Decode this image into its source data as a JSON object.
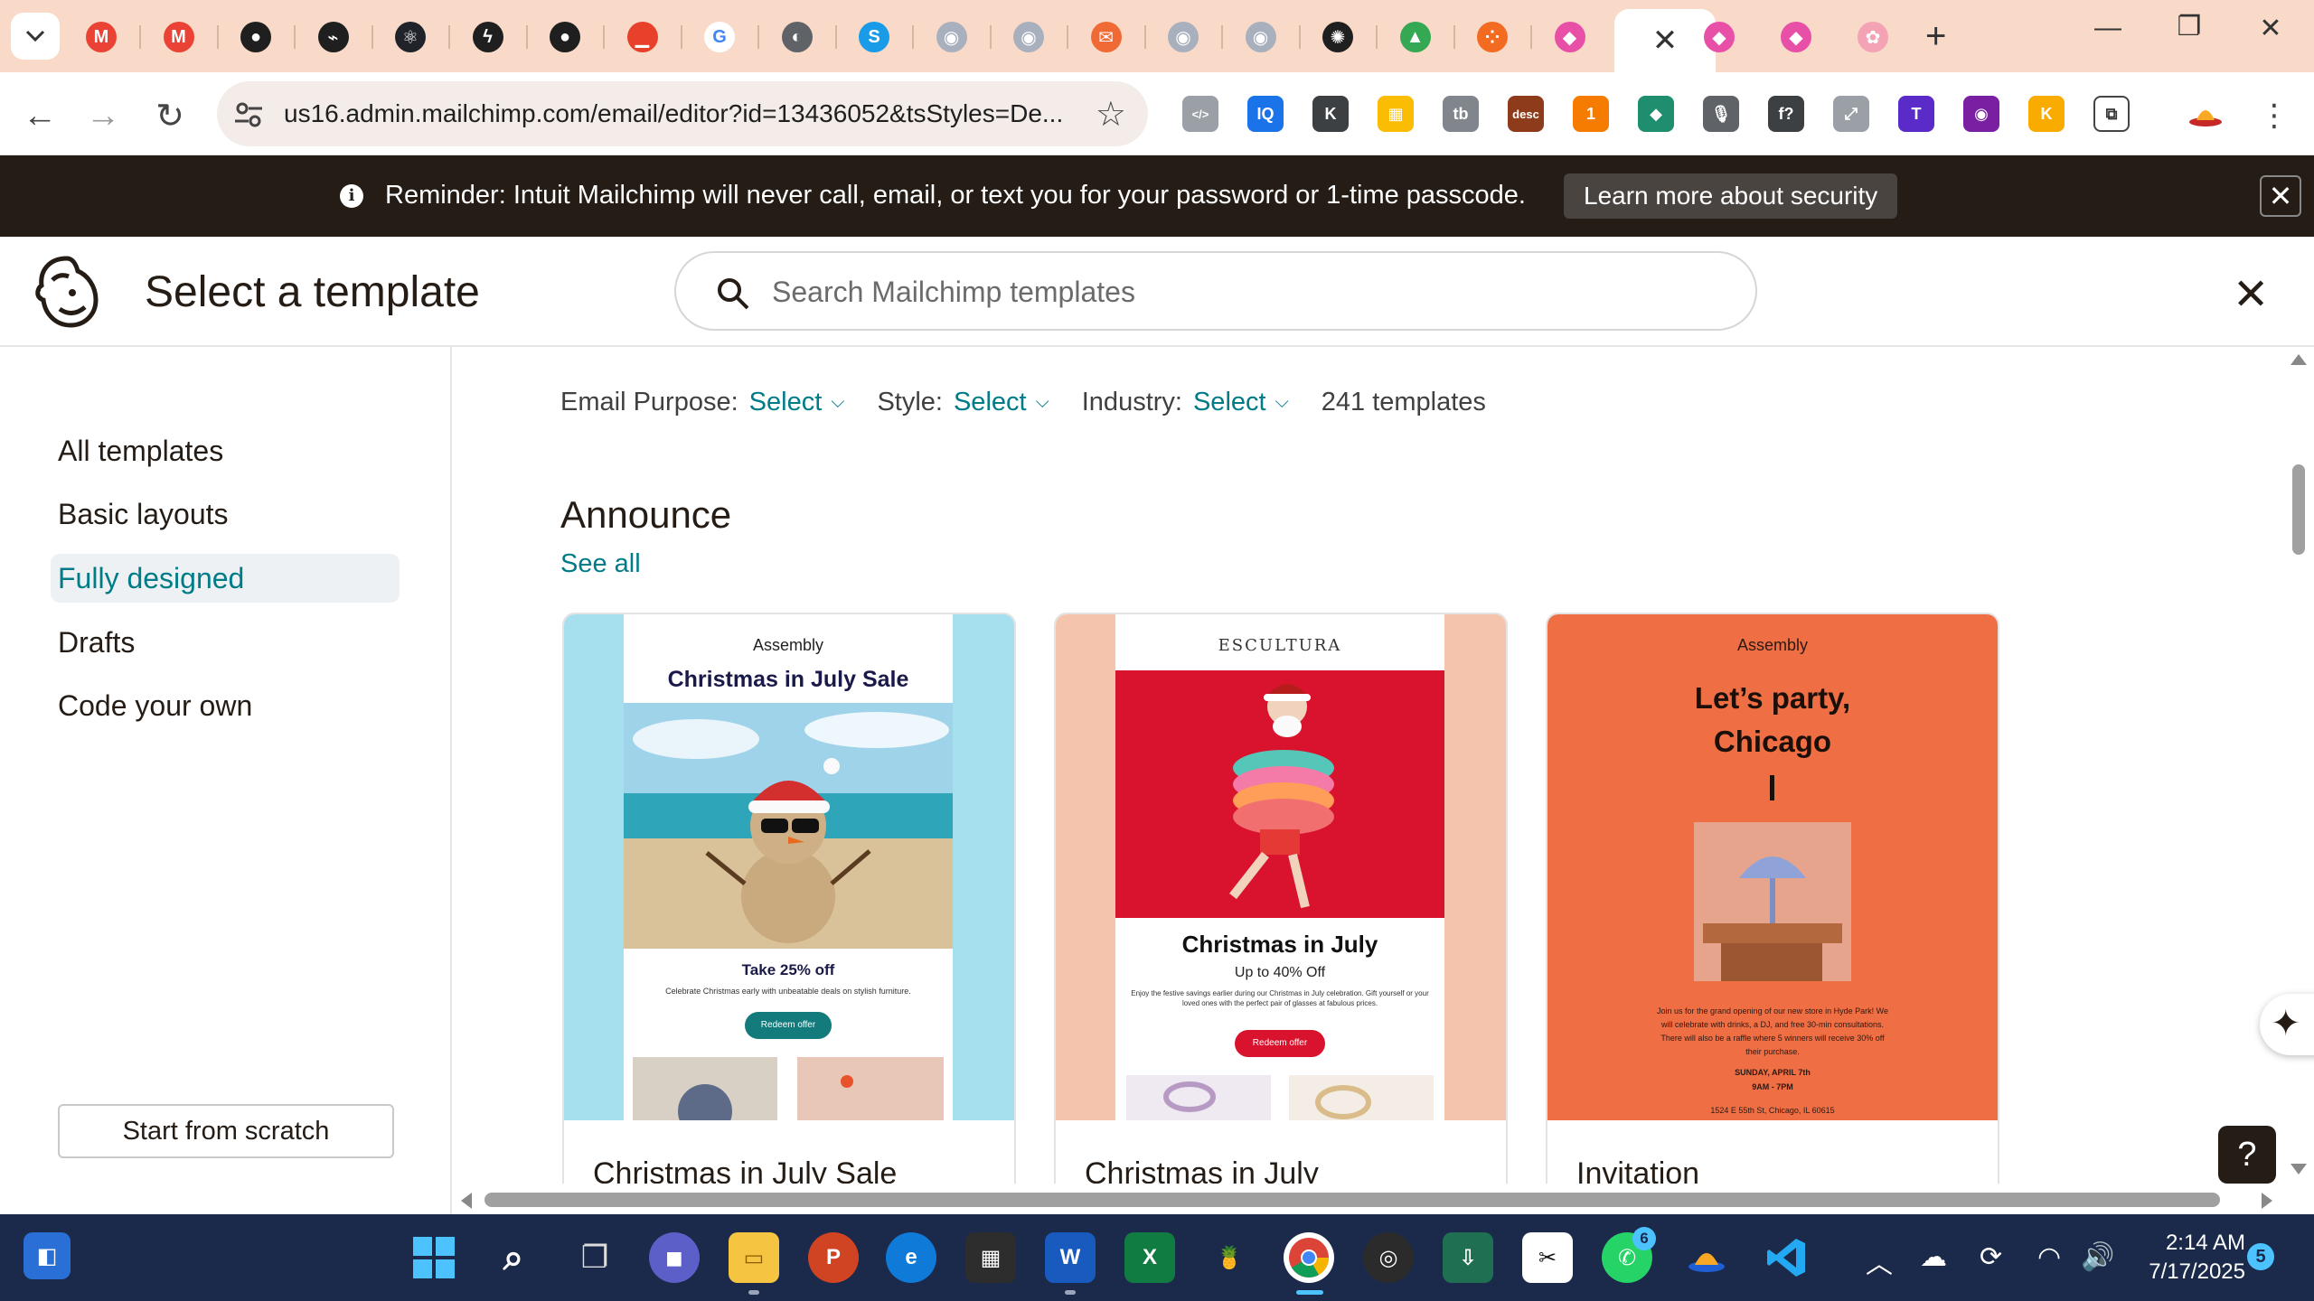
{
  "browser": {
    "url": "us16.admin.mailchimp.com/email/editor?id=13436052&tsStyles=De...",
    "tabs": [
      {
        "icon": "gmail-icon",
        "color": "#ea4335",
        "glyph": "M"
      },
      {
        "icon": "gmail-icon",
        "color": "#ea4335",
        "glyph": "M"
      },
      {
        "icon": "github-icon",
        "color": "#1f1f1f",
        "glyph": "●"
      },
      {
        "icon": "link-tool-icon",
        "color": "#1f1f1f",
        "glyph": "⌁"
      },
      {
        "icon": "react-icon",
        "color": "#20232a",
        "glyph": "⚛"
      },
      {
        "icon": "supabase-icon",
        "color": "#1f1f1f",
        "glyph": "ϟ"
      },
      {
        "icon": "github-icon",
        "color": "#1f1f1f",
        "glyph": "●"
      },
      {
        "icon": "red-square-icon",
        "color": "#e8412b",
        "glyph": "▁"
      },
      {
        "icon": "google-icon",
        "color": "#ffffff",
        "glyph": "G"
      },
      {
        "icon": "globe-icon",
        "color": "#5f6368",
        "glyph": "◐"
      },
      {
        "icon": "skype-icon",
        "color": "#1a9be8",
        "glyph": "S"
      },
      {
        "icon": "avatar-tab-icon",
        "color": "#a8b0bd",
        "glyph": "◉"
      },
      {
        "icon": "avatar-tab-icon",
        "color": "#a8b0bd",
        "glyph": "◉"
      },
      {
        "icon": "mail-icon",
        "color": "#f06a35",
        "glyph": "✉"
      },
      {
        "icon": "avatar-tab-icon",
        "color": "#a8b0bd",
        "glyph": "◉"
      },
      {
        "icon": "avatar-tab-icon",
        "color": "#a8b0bd",
        "glyph": "◉"
      },
      {
        "icon": "openai-icon",
        "color": "#1f1f1f",
        "glyph": "✺"
      },
      {
        "icon": "google-drive-icon",
        "color": "#34a853",
        "glyph": "▲"
      },
      {
        "icon": "dots-app-icon",
        "color": "#f36b21",
        "glyph": "⁘"
      },
      {
        "icon": "clickup-icon",
        "color": "#e84fa7",
        "glyph": "◆"
      }
    ],
    "tabs_right": [
      {
        "icon": "clickup-icon",
        "color": "#e84fa7",
        "glyph": "◆"
      },
      {
        "icon": "clickup-icon",
        "color": "#e84fa7",
        "glyph": "◆"
      },
      {
        "icon": "brain-icon",
        "color": "#f4a3b5",
        "glyph": "✿"
      }
    ],
    "extensions": [
      {
        "icon": "code-ext-icon",
        "color": "#9aa0a6",
        "glyph": "</>"
      },
      {
        "icon": "iq-ext-icon",
        "color": "#1a73e8",
        "glyph": "IQ"
      },
      {
        "icon": "k-ext-icon",
        "color": "#3c4043",
        "glyph": "K"
      },
      {
        "icon": "grid-ext-icon",
        "color": "#fbbc04",
        "glyph": "▦"
      },
      {
        "icon": "tb-ext-icon",
        "color": "#80868b",
        "glyph": "tb"
      },
      {
        "icon": "desc-ext-icon",
        "color": "#8d3b1b",
        "glyph": "desc"
      },
      {
        "icon": "badge-ext-icon",
        "color": "#f57c00",
        "glyph": "1"
      },
      {
        "icon": "diamond-ext-icon",
        "color": "#1e8e6e",
        "glyph": "◆"
      },
      {
        "icon": "mic-icon",
        "color": "#5f6368",
        "glyph": "🎙"
      },
      {
        "icon": "formula-ext-icon",
        "color": "#3c4043",
        "glyph": "f?"
      },
      {
        "icon": "expand-icon",
        "color": "#9aa0a6",
        "glyph": "⤢"
      },
      {
        "icon": "t-ext-icon",
        "color": "#5b2bc9",
        "glyph": "T"
      },
      {
        "icon": "eye-ext-icon",
        "color": "#7b1fa2",
        "glyph": "◉"
      },
      {
        "icon": "k-yellow-ext-icon",
        "color": "#f9ab00",
        "glyph": "K"
      },
      {
        "icon": "puzzle-icon",
        "color": "#ffffff",
        "glyph": "⧉"
      }
    ]
  },
  "banner": {
    "message": "Reminder: Intuit Mailchimp will never call, email, or text you for your password or 1-time passcode.",
    "button": "Learn more about security"
  },
  "header": {
    "title": "Select a template",
    "search_placeholder": "Search Mailchimp templates"
  },
  "sidebar": {
    "items": [
      {
        "label": "All templates",
        "active": false
      },
      {
        "label": "Basic layouts",
        "active": false
      },
      {
        "label": "Fully designed",
        "active": true
      },
      {
        "label": "Drafts",
        "active": false
      },
      {
        "label": "Code your own",
        "active": false
      }
    ],
    "scratch_button": "Start from scratch"
  },
  "filters": {
    "email_purpose_label": "Email Purpose:",
    "email_purpose_value": "Select",
    "style_label": "Style:",
    "style_value": "Select",
    "industry_label": "Industry:",
    "industry_value": "Select",
    "count": "241 templates"
  },
  "section": {
    "title": "Announce",
    "see_all": "See all"
  },
  "cards": [
    {
      "name": "Christmas in July Sale",
      "brand": "Assembly",
      "headline": "Christmas in July Sale",
      "offer": "Take 25% off",
      "body": "Celebrate Christmas early with unbeatable deals on stylish furniture.",
      "cta": "Redeem offer"
    },
    {
      "name": "Christmas in July",
      "brand": "ESCULTURA",
      "headline": "Christmas in July",
      "offer": "Up to 40% Off",
      "body": "Enjoy the festive savings earlier during our Christmas in July celebration. Gift yourself or your loved ones with the perfect pair of glasses at fabulous prices.",
      "cta": "Redeem offer"
    },
    {
      "name": "Invitation",
      "brand": "Assembly",
      "headline_1": "Let’s party,",
      "headline_2": "Chicago",
      "body": "Join us for the grand opening of our new store in Hyde Park! We will celebrate with drinks, a DJ, and free 30-min consultations. There will also be a raffle where 5 winners will receive 30% off their purchase.",
      "date": "SUNDAY, APRIL 7th",
      "time": "9AM - 7PM",
      "address": "1524 E 55th St, Chicago, IL 60615"
    }
  ],
  "colors": {
    "accent": "#007c89",
    "banner_bg": "#241c15",
    "tab_strip": "#f9d9c7",
    "card1_bg": "#a6e0ee",
    "card2_bg": "#f5c4ad",
    "card3_bg": "#f06e43"
  },
  "help_label": "?",
  "taskbar": {
    "time": "2:14 AM",
    "date": "7/17/2025",
    "notifications": "5",
    "whatsapp_badge": "6"
  }
}
